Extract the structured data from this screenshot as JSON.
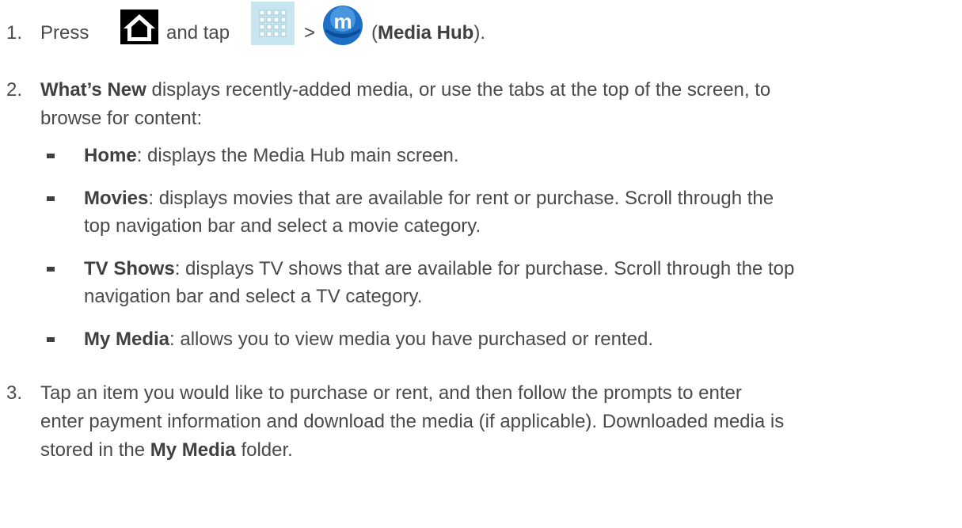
{
  "step1": {
    "number": "1.",
    "press": "Press",
    "and_tap": "and tap",
    "gt": ">",
    "paren_open": "(",
    "media_hub": "Media Hub",
    "paren_close": ")."
  },
  "step2": {
    "number": "2.",
    "whats_new": "What’s New",
    "text_line1": " displays recently-added media, or use the tabs at the top of the screen, to",
    "text_line2": "browse for content:",
    "items": [
      {
        "bold": "Home",
        "line1": ": displays the Media Hub main screen.",
        "line2": ""
      },
      {
        "bold": "Movies",
        "line1": ": displays movies that are available for rent or purchase. Scroll through the",
        "line2": "top navigation bar and select a movie category."
      },
      {
        "bold": "TV Shows",
        "line1": ": displays TV shows that are available for purchase. Scroll through the top",
        "line2": "navigation bar and select a TV category."
      },
      {
        "bold": "My Media",
        "line1": ": allows you to view media you have purchased or rented.",
        "line2": ""
      }
    ]
  },
  "step3": {
    "number": "3.",
    "line1": "Tap an item you would like to purchase or rent, and then follow the prompts to enter",
    "line2": "enter payment information and download the media (if applicable). Downloaded media is",
    "line3_pre": "stored in the ",
    "line3_bold": "My Media",
    "line3_post": " folder."
  },
  "icons": {
    "home": "home-icon",
    "apps": "apps-grid-icon",
    "media_hub": "media-hub-icon"
  },
  "colors": {
    "text": "#4a4a4a",
    "bold_text": "#404040",
    "apps_icon_bg": "#c8e6ef",
    "media_hub_blue": "#1e6fc6"
  }
}
